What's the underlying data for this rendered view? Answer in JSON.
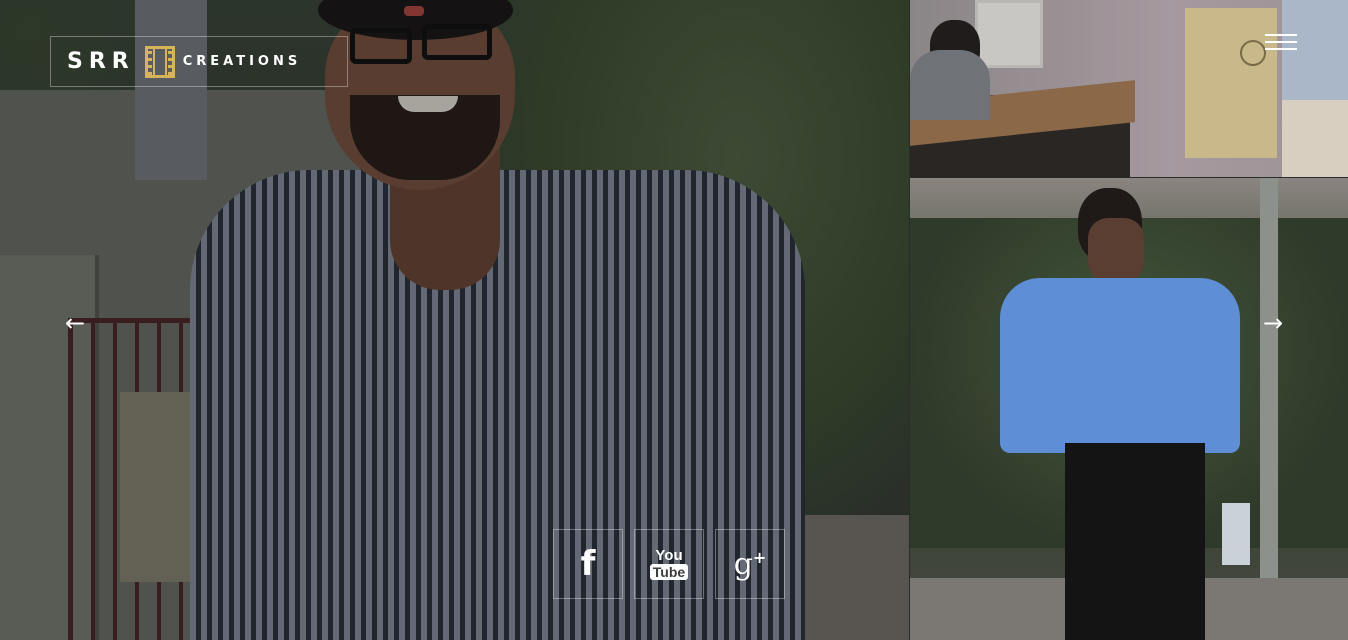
{
  "brand": {
    "name": "SRR",
    "subtitle": "CREATIONS",
    "emblem_icon": "film-strip-icon",
    "accent_color": "#d7b35a"
  },
  "menu": {
    "icon": "hamburger-menu-icon"
  },
  "slider": {
    "prev_arrow": "←",
    "next_arrow": "→"
  },
  "social": {
    "facebook": "f",
    "youtube_top": "You",
    "youtube_bottom": "Tube",
    "google_plus": "g",
    "google_plus_sup": "+"
  }
}
